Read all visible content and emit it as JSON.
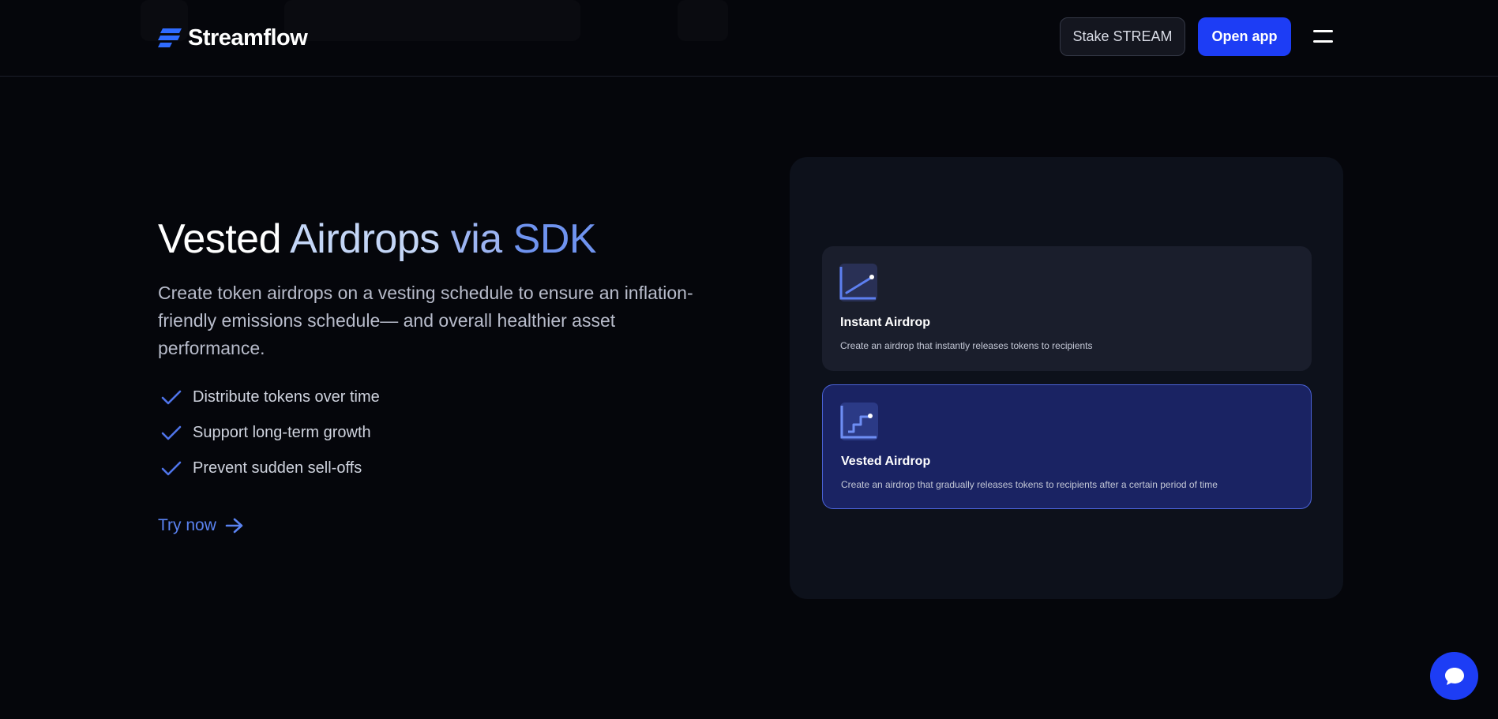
{
  "header": {
    "logo_text": "Streamflow",
    "stake_label": "Stake STREAM",
    "open_app_label": "Open app"
  },
  "hero": {
    "title_parts": [
      "Vested",
      "Airdrops",
      "via",
      "SDK"
    ],
    "description": "Create token airdrops on a vesting schedule to ensure an inflation-friendly emissions schedule— and overall healthier asset performance.",
    "features": [
      "Distribute tokens over time",
      "Support long-term growth",
      "Prevent sudden sell-offs"
    ],
    "cta_label": "Try now"
  },
  "preview": {
    "options": [
      {
        "title": "Instant Airdrop",
        "description": "Create an airdrop that instantly releases tokens to recipients",
        "icon": "rising-chart-icon",
        "selected": false
      },
      {
        "title": "Vested Airdrop",
        "description": "Create an airdrop that gradually releases tokens to recipients after a certain period of time",
        "icon": "step-chart-icon",
        "selected": true
      }
    ]
  },
  "icons": {
    "menu": "hamburger-menu-icon",
    "chat": "chat-bubble-icon",
    "check": "check-icon",
    "arrow": "arrow-right-icon"
  },
  "colors": {
    "background": "#05060b",
    "accent": "#1d3df5",
    "link": "#5a82f0",
    "selected_border": "#4b63d8"
  }
}
